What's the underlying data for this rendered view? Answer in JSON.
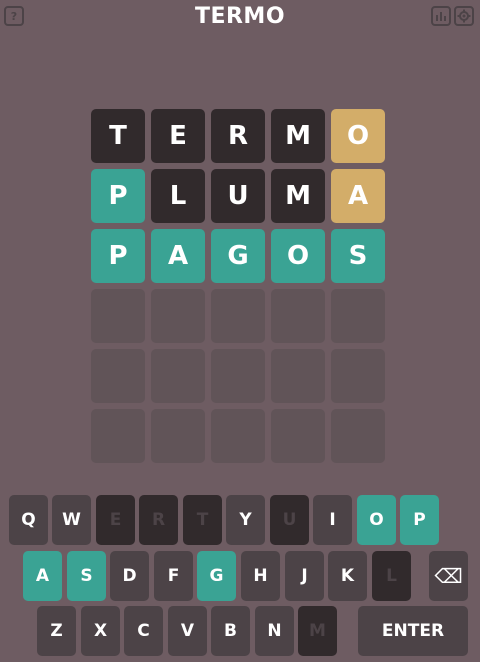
{
  "header": {
    "title": "TERMO",
    "help_label": "?"
  },
  "board": {
    "rows": [
      [
        {
          "l": "T",
          "s": "wrong"
        },
        {
          "l": "E",
          "s": "wrong"
        },
        {
          "l": "R",
          "s": "wrong"
        },
        {
          "l": "M",
          "s": "wrong"
        },
        {
          "l": "O",
          "s": "place"
        }
      ],
      [
        {
          "l": "P",
          "s": "right"
        },
        {
          "l": "L",
          "s": "wrong"
        },
        {
          "l": "U",
          "s": "wrong"
        },
        {
          "l": "M",
          "s": "wrong"
        },
        {
          "l": "A",
          "s": "place"
        }
      ],
      [
        {
          "l": "P",
          "s": "right"
        },
        {
          "l": "A",
          "s": "right"
        },
        {
          "l": "G",
          "s": "right"
        },
        {
          "l": "O",
          "s": "right"
        },
        {
          "l": "S",
          "s": "right"
        }
      ],
      [
        {
          "l": "",
          "s": "empty"
        },
        {
          "l": "",
          "s": "empty"
        },
        {
          "l": "",
          "s": "empty"
        },
        {
          "l": "",
          "s": "empty"
        },
        {
          "l": "",
          "s": "empty"
        }
      ],
      [
        {
          "l": "",
          "s": "empty"
        },
        {
          "l": "",
          "s": "empty"
        },
        {
          "l": "",
          "s": "empty"
        },
        {
          "l": "",
          "s": "empty"
        },
        {
          "l": "",
          "s": "empty"
        }
      ],
      [
        {
          "l": "",
          "s": "empty"
        },
        {
          "l": "",
          "s": "empty"
        },
        {
          "l": "",
          "s": "empty"
        },
        {
          "l": "",
          "s": "empty"
        },
        {
          "l": "",
          "s": "empty"
        }
      ]
    ]
  },
  "keyboard": {
    "row1": [
      {
        "label": "Q",
        "state": "normal"
      },
      {
        "label": "W",
        "state": "normal"
      },
      {
        "label": "E",
        "state": "used"
      },
      {
        "label": "R",
        "state": "used"
      },
      {
        "label": "T",
        "state": "used"
      },
      {
        "label": "Y",
        "state": "normal"
      },
      {
        "label": "U",
        "state": "used"
      },
      {
        "label": "I",
        "state": "normal"
      },
      {
        "label": "O",
        "state": "right"
      },
      {
        "label": "P",
        "state": "right"
      }
    ],
    "row2": [
      {
        "label": "A",
        "state": "right"
      },
      {
        "label": "S",
        "state": "right"
      },
      {
        "label": "D",
        "state": "normal"
      },
      {
        "label": "F",
        "state": "normal"
      },
      {
        "label": "G",
        "state": "right"
      },
      {
        "label": "H",
        "state": "normal"
      },
      {
        "label": "J",
        "state": "normal"
      },
      {
        "label": "K",
        "state": "normal"
      },
      {
        "label": "L",
        "state": "used"
      },
      {
        "label": "⌫",
        "state": "normal",
        "name": "backspace-key"
      }
    ],
    "row3": [
      {
        "label": "Z",
        "state": "normal"
      },
      {
        "label": "X",
        "state": "normal"
      },
      {
        "label": "C",
        "state": "normal"
      },
      {
        "label": "V",
        "state": "normal"
      },
      {
        "label": "B",
        "state": "normal"
      },
      {
        "label": "N",
        "state": "normal"
      },
      {
        "label": "M",
        "state": "used"
      },
      {
        "label": "ENTER",
        "state": "normal",
        "name": "enter-key"
      }
    ]
  },
  "colors": {
    "background": "#6e5c62",
    "wrong": "#312a2c",
    "place": "#d3ad69",
    "right": "#3aa394",
    "key": "#4c4347",
    "empty": "#615458"
  }
}
